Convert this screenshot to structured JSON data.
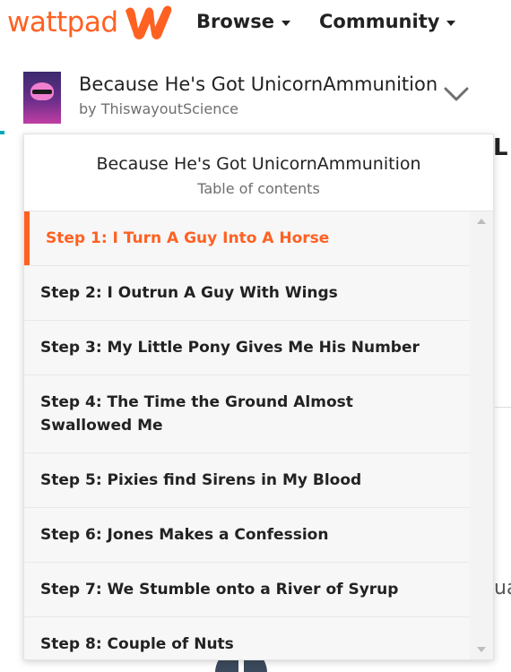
{
  "brand": {
    "name": "wattpad",
    "color": "#ff6122",
    "icon": "wattpad-w-logo"
  },
  "nav": {
    "browse_label": "Browse",
    "community_label": "Community"
  },
  "story": {
    "title": "Because He's Got UnicornAmmunition",
    "author": "by ThiswayoutScience",
    "cover_icon": "book-cover"
  },
  "toc": {
    "title": "Because He's Got UnicornAmmunition",
    "subtitle": "Table of contents",
    "active_index": 0,
    "items": [
      {
        "label": "Step 1: I Turn A Guy Into A Horse"
      },
      {
        "label": "Step 2: I Outrun A Guy With Wings"
      },
      {
        "label": "Step 3: My Little Pony Gives Me His Number"
      },
      {
        "label": "Step 4: The Time the Ground Almost Swallowed Me"
      },
      {
        "label": "Step 5: Pixies find Sirens in My Blood"
      },
      {
        "label": "Step 6: Jones Makes a Confession"
      },
      {
        "label": "Step 7: We Stumble onto a River of Syrup"
      },
      {
        "label": "Step 8: Couple of Nuts"
      }
    ]
  },
  "background": {
    "glyph": "L",
    "text_fragment": "ua"
  }
}
